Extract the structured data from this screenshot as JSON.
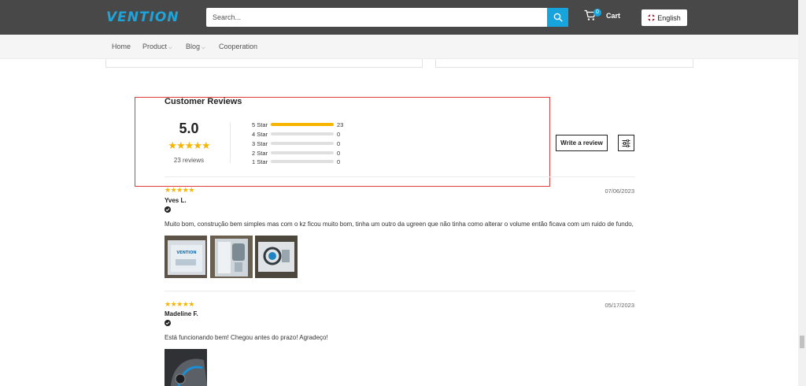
{
  "header": {
    "logo": "VENTION",
    "search_placeholder": "Search...",
    "cart_count": "0",
    "cart_label": "Cart",
    "language": "English"
  },
  "nav": {
    "items": [
      {
        "label": "Home"
      },
      {
        "label": "Product"
      },
      {
        "label": "Blog"
      },
      {
        "label": "Cooperation"
      }
    ]
  },
  "reviews_summary": {
    "title": "Customer Reviews",
    "average": "5.0",
    "stars": "★★★★★",
    "count_text": "23 reviews",
    "distribution": [
      {
        "label": "5 Star",
        "count": "23",
        "fraction": 1.0
      },
      {
        "label": "4 Star",
        "count": "0",
        "fraction": 0
      },
      {
        "label": "3 Star",
        "count": "0",
        "fraction": 0
      },
      {
        "label": "2 Star",
        "count": "0",
        "fraction": 0
      },
      {
        "label": "1 Star",
        "count": "0",
        "fraction": 0
      }
    ],
    "write_review_label": "Write a review"
  },
  "reviews": [
    {
      "stars": "★★★★★",
      "date": "07/06/2023",
      "name": "Yves L.",
      "text": "Muito bom, construção bem simples mas com o kz ficou muito bom, tinha um outro da ugreen que não tinha como alterar o volume então ficava com um ruido de fundo, já esse não"
    },
    {
      "stars": "★★★★★",
      "date": "05/17/2023",
      "name": "Madeline F.",
      "text": "Está funcionando bem! Chegou antes do prazo! Agradeço!"
    }
  ],
  "colors": {
    "topbar": "#484848",
    "accent": "#17a4dc",
    "star": "#f7b500",
    "highlight_border": "#e23b3b"
  }
}
